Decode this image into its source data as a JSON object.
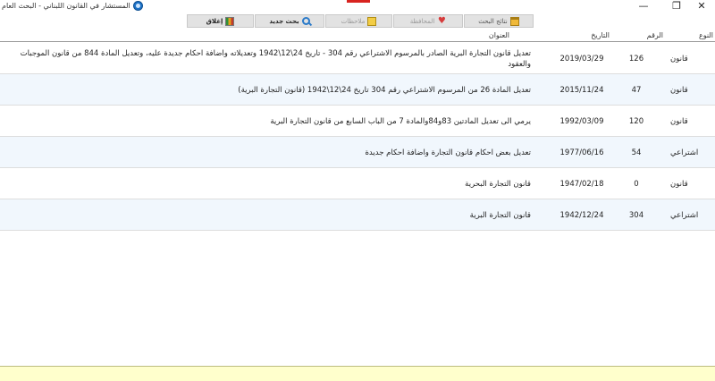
{
  "window": {
    "title": "المستشار في القانون اللبناني - البحث العام",
    "app_icon": "app-globe-icon",
    "controls": {
      "minimize": "—",
      "maximize": "❐",
      "close": "✕"
    }
  },
  "toolbar": {
    "close_label": "إغلاق",
    "new_search_label": "بحث جديد",
    "notes_label": "ملاحظات",
    "save_label": "المحافظة",
    "results_label": "نتائج البحث"
  },
  "table": {
    "headers": {
      "type": "النوع",
      "number": "الرقم",
      "date": "التاريخ",
      "title": "العنوان"
    },
    "rows": [
      {
        "type": "قانون",
        "number": "126",
        "date": "2019/03/29",
        "title": "تعديل قانون التجارة البرية الصادر بالمرسوم الاشتراعي رقم 304 - تاريخ 24\\12\\1942 وتعديلاته واضافة احكام جديدة عليه، وتعديل المادة 844 من قانون الموجبات والعقود"
      },
      {
        "type": "قانون",
        "number": "47",
        "date": "2015/11/24",
        "title": "تعديل المادة 26 من المرسوم الاشتراعي رقم 304 تاريخ 24\\12\\1942 (قانون التجارة البرية)"
      },
      {
        "type": "قانون",
        "number": "120",
        "date": "1992/03/09",
        "title": "يرمي الى تعديل المادتين 83و84والمادة 7 من الباب السابع من قانون التجارة البرية"
      },
      {
        "type": "اشتراعي",
        "number": "54",
        "date": "1977/06/16",
        "title": "تعديل بعض احكام قانون التجارة واضافة احكام جديدة"
      },
      {
        "type": "قانون",
        "number": "0",
        "date": "1947/02/18",
        "title": "قانون التجارة البحرية"
      },
      {
        "type": "اشتراعي",
        "number": "304",
        "date": "1942/12/24",
        "title": "قانون التجارة البرية"
      }
    ]
  },
  "status": {
    "text": ""
  }
}
